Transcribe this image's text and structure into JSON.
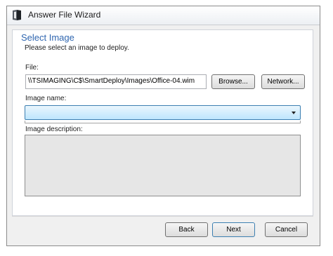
{
  "window": {
    "title": "Answer File Wizard"
  },
  "page": {
    "heading": "Select Image",
    "subheading": "Please select an image to deploy."
  },
  "file": {
    "label": "File:",
    "value": "\\\\TSIMAGING\\C$\\SmartDeploy\\Images\\Office-04.wim",
    "browse_label": "Browse...",
    "network_label": "Network..."
  },
  "image_name": {
    "label": "Image name:",
    "selected": ""
  },
  "image_description": {
    "label": "Image description:",
    "value": ""
  },
  "footer": {
    "back_label": "Back",
    "next_label": "Next",
    "cancel_label": "Cancel"
  },
  "colors": {
    "heading": "#2f66b0",
    "select_border": "#3c7fb1",
    "default_button_border": "#3c7fb1"
  },
  "icons": {
    "app": "answer-file-wizard-app-icon",
    "dropdown": "chevron-down-icon"
  }
}
